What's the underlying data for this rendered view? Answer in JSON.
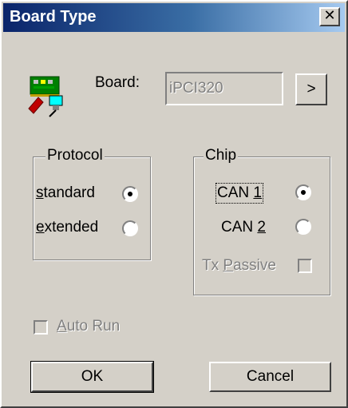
{
  "window": {
    "title": "Board Type",
    "close_glyph": "✕"
  },
  "board": {
    "label": "Board:",
    "value": "iPCI320",
    "browse_label": ">"
  },
  "protocol": {
    "legend": "Protocol",
    "options": [
      {
        "pre": "",
        "key": "s",
        "post": "tandard",
        "checked": true
      },
      {
        "pre": "",
        "key": "e",
        "post": "xtended",
        "checked": false
      }
    ]
  },
  "chip": {
    "legend": "Chip",
    "options": [
      {
        "pre": "CAN ",
        "key": "1",
        "post": "",
        "checked": true
      },
      {
        "pre": "CAN ",
        "key": "2",
        "post": "",
        "checked": false
      }
    ],
    "tx_passive": {
      "pre": "Tx ",
      "key": "P",
      "post": "assive",
      "checked": false,
      "enabled": false
    }
  },
  "auto_run": {
    "pre": "",
    "key": "A",
    "post": "uto Run",
    "checked": false,
    "enabled": false
  },
  "buttons": {
    "ok": "OK",
    "cancel": "Cancel"
  },
  "icon": {
    "name": "board-card-icon"
  }
}
